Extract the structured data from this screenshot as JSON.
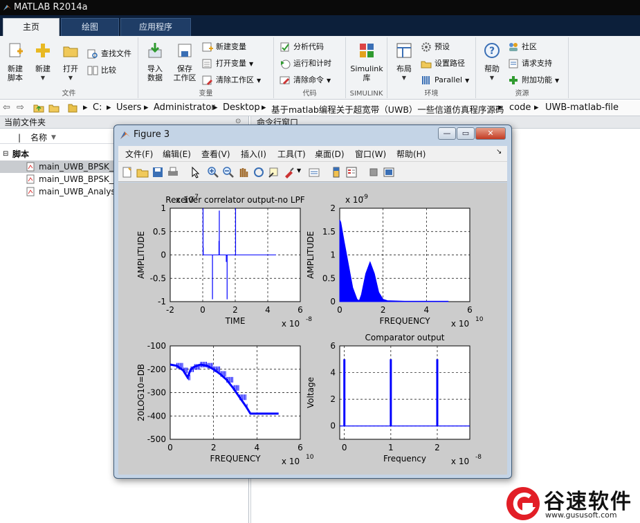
{
  "app": {
    "title": "MATLAB R2014a"
  },
  "tabs": [
    {
      "label": "主页"
    },
    {
      "label": "绘图"
    },
    {
      "label": "应用程序"
    }
  ],
  "ribbon": {
    "file": {
      "label": "文件",
      "new_script": "新建\n脚本",
      "new": "新建",
      "open": "打开",
      "find_files": "查找文件",
      "compare": "比较"
    },
    "variable": {
      "label": "变量",
      "import": "导入\n数据",
      "save_ws": "保存\n工作区",
      "new_var": "新建变量",
      "open_var": "打开变量",
      "clear_ws": "清除工作区"
    },
    "code": {
      "label": "代码",
      "analyze": "分析代码",
      "run_time": "运行和计时",
      "clear_cmd": "清除命令"
    },
    "simulink": {
      "label": "SIMULINK",
      "lib": "Simulink\n库"
    },
    "env": {
      "label": "环境",
      "layout": "布局",
      "prefs": "预设",
      "set_path": "设置路径",
      "parallel": "Parallel"
    },
    "resources": {
      "label": "资源",
      "help": "帮助",
      "community": "社区",
      "support": "请求支持",
      "addons": "附加功能"
    }
  },
  "address": {
    "segments": [
      "C:",
      "Users",
      "Administrator",
      "Desktop",
      "基于matlab编程关于超宽带（UWB）一些信道仿真程序源码",
      "code",
      "UWB-matlab-file"
    ]
  },
  "left_panel": {
    "title": "当前文件夹",
    "col_name": "名称",
    "group": "脚本",
    "files": [
      "main_UWB_BPSK_F",
      "main_UWB_BPSK_A",
      "main_UWB_Analysi"
    ]
  },
  "right_panel": {
    "title": "命令行窗口"
  },
  "figure": {
    "title": "Figure 3",
    "menu": [
      "文件(F)",
      "编辑(E)",
      "查看(V)",
      "插入(I)",
      "工具(T)",
      "桌面(D)",
      "窗口(W)",
      "帮助(H)"
    ]
  },
  "chart_data": [
    {
      "type": "line",
      "title": "Receiver correlator output-no LPF",
      "xlabel": "TIME",
      "ylabel": "AMPLITUDE",
      "xlim": [
        -2,
        6
      ],
      "ylim": [
        -1,
        1
      ],
      "xticks": [
        "-2",
        "0",
        "2",
        "4",
        "6"
      ],
      "yticks": [
        "-1",
        "-0.5",
        "0",
        "0.5",
        "1"
      ],
      "x_exponent": "x 10",
      "x_exp_power": "-8",
      "y_exponent": "x 10",
      "y_exp_power": "-7",
      "grid": true,
      "series": [
        {
          "x": [
            0,
            0.02,
            0.02,
            0.05,
            0.05,
            1.0,
            1.0,
            1.02,
            1.02,
            2.0,
            2.0,
            2.02,
            2.02,
            4.5
          ],
          "y": [
            0,
            1.0,
            0,
            0.15,
            0,
            0,
            0.3,
            0,
            0.95,
            0,
            1.0,
            0,
            -0.15,
            0
          ]
        }
      ],
      "spikes_down": [
        {
          "x": 0.6,
          "y": -0.95
        },
        {
          "x": 1.5,
          "y": -0.95
        },
        {
          "x": 0.03,
          "y": 0.16
        }
      ]
    },
    {
      "type": "area",
      "title": "",
      "xlabel": "FREQUENCY",
      "ylabel": "AMPLITUDE",
      "xlim": [
        0,
        6
      ],
      "ylim": [
        0,
        2
      ],
      "xticks": [
        "0",
        "2",
        "4",
        "6"
      ],
      "yticks": [
        "0",
        "0.5",
        "1",
        "1.5",
        "2"
      ],
      "x_exponent": "x 10",
      "x_exp_power": "10",
      "y_exponent": "x 10",
      "y_exp_power": "-9",
      "grid": true,
      "series": [
        {
          "x": [
            0,
            0.05,
            0.2,
            0.4,
            0.6,
            0.8,
            0.9,
            1.0,
            1.2,
            1.4,
            1.6,
            1.8,
            2.0,
            2.2,
            3.0,
            5.0
          ],
          "y": [
            1.75,
            1.7,
            1.3,
            0.8,
            0.3,
            0.05,
            0.02,
            0.15,
            0.6,
            0.85,
            0.6,
            0.2,
            0.05,
            0.02,
            0.01,
            0.01
          ]
        }
      ]
    },
    {
      "type": "line",
      "title": "",
      "xlabel": "FREQUENCY",
      "ylabel": "20LOG10=DB",
      "xlim": [
        0,
        6
      ],
      "ylim": [
        -500,
        -100
      ],
      "xticks": [
        "0",
        "2",
        "4",
        "6"
      ],
      "yticks": [
        "-500",
        "-400",
        "-300",
        "-200",
        "-100"
      ],
      "x_exponent": "x 10",
      "x_exp_power": "10",
      "grid": true,
      "series": [
        {
          "x": [
            0,
            0.3,
            0.6,
            0.8,
            0.95,
            1.1,
            1.4,
            1.7,
            2.0,
            2.3,
            2.6,
            2.9,
            3.2,
            3.5,
            3.7,
            3.8,
            5.0
          ],
          "y": [
            -180,
            -185,
            -205,
            -235,
            -200,
            -190,
            -180,
            -185,
            -200,
            -220,
            -245,
            -280,
            -320,
            -360,
            -390,
            -390,
            -390
          ]
        }
      ]
    },
    {
      "type": "bar",
      "title": "Comparator output",
      "xlabel": "Frequency",
      "ylabel": "Voltage",
      "xlim": [
        -0.1,
        2.7
      ],
      "ylim": [
        -1,
        6
      ],
      "xticks": [
        "0",
        "1",
        "2"
      ],
      "yticks": [
        "0",
        "2",
        "4",
        "6"
      ],
      "x_exponent": "x 10",
      "x_exp_power": "-8",
      "grid": true,
      "pulses": [
        {
          "x": 0,
          "y": 5
        },
        {
          "x": 1,
          "y": 5
        },
        {
          "x": 2,
          "y": 5
        }
      ]
    }
  ],
  "watermark": {
    "brand": "谷速软件",
    "url": "www.gususoft.com"
  },
  "colors": {
    "plot_line": "#0000ff",
    "ribbon_bg": "#f1f3f5",
    "tab_bar": "#0c1f3a"
  }
}
